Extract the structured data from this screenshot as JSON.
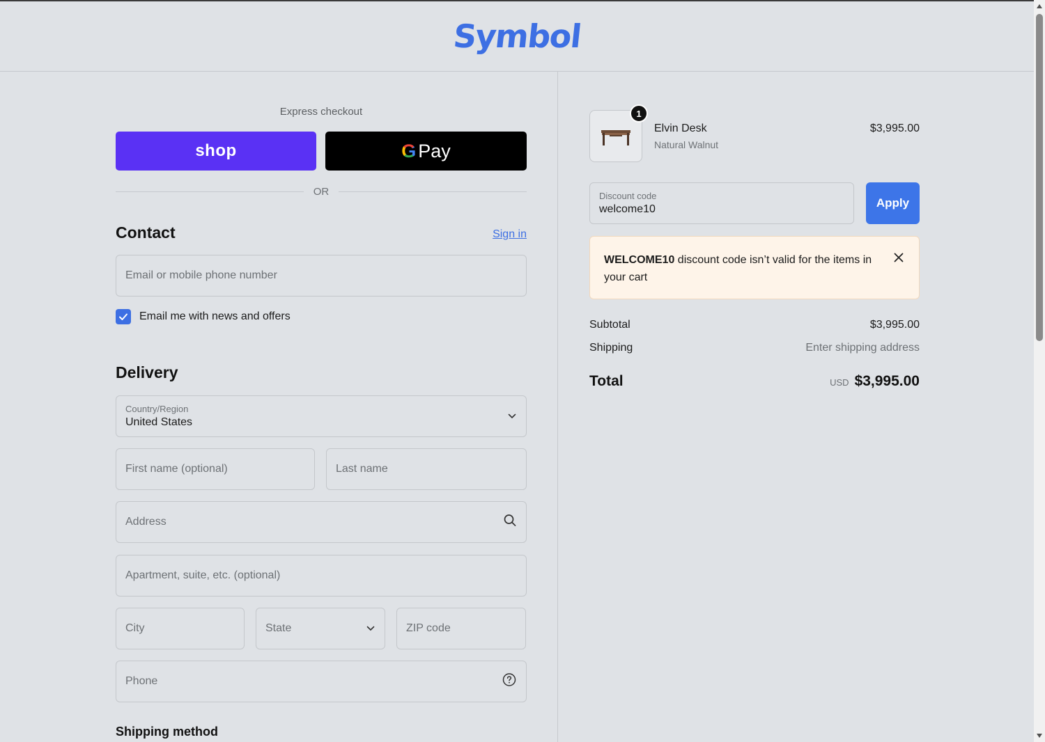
{
  "header": {
    "logo": "Symbol"
  },
  "express": {
    "label": "Express checkout",
    "shop_label": "shop",
    "gpay_g": "G",
    "gpay_label": "Pay",
    "or_label": "OR"
  },
  "contact": {
    "heading": "Contact",
    "signin_label": "Sign in",
    "email_placeholder": "Email or mobile phone number",
    "newsletter_label": "Email me with news and offers",
    "newsletter_checked": true
  },
  "delivery": {
    "heading": "Delivery",
    "country_label": "Country/Region",
    "country_value": "United States",
    "first_name_placeholder": "First name (optional)",
    "last_name_placeholder": "Last name",
    "address_placeholder": "Address",
    "apartment_placeholder": "Apartment, suite, etc. (optional)",
    "city_placeholder": "City",
    "state_placeholder": "State",
    "zip_placeholder": "ZIP code",
    "phone_placeholder": "Phone"
  },
  "shipping_method": {
    "heading": "Shipping method"
  },
  "order": {
    "item": {
      "quantity": "1",
      "name": "Elvin Desk",
      "variant": "Natural Walnut",
      "price": "$3,995.00"
    },
    "discount": {
      "label": "Discount code",
      "value": "welcome10",
      "apply_label": "Apply"
    },
    "alert": {
      "code": "WELCOME10",
      "message": " discount code isn’t valid for the items in your cart"
    },
    "subtotal_label": "Subtotal",
    "subtotal_value": "$3,995.00",
    "shipping_label": "Shipping",
    "shipping_value": "Enter shipping address",
    "total_label": "Total",
    "total_currency": "USD",
    "total_value": "$3,995.00"
  },
  "colors": {
    "accent": "#3d6fe3",
    "shop_purple": "#5a31f4",
    "alert_bg": "#fef4e9"
  }
}
